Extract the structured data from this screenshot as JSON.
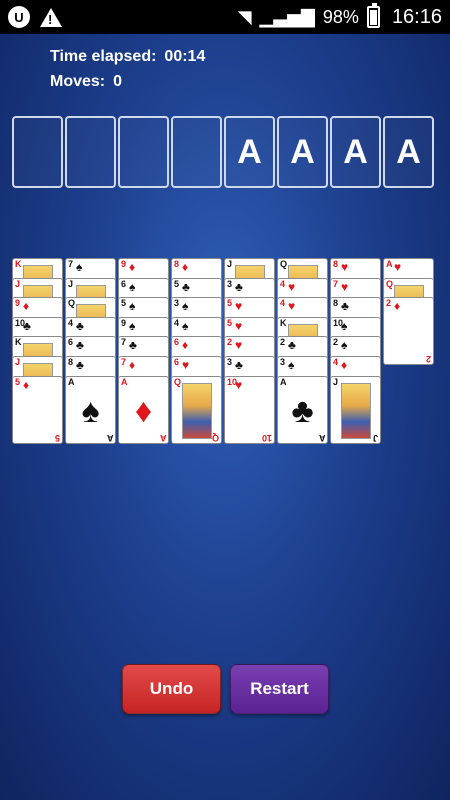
{
  "status_bar": {
    "app_icon": "U",
    "warning_icon": "!",
    "battery": "98%",
    "time": "16:16"
  },
  "hud": {
    "time_label": "Time elapsed:",
    "time_value": "00:14",
    "moves_label": "Moves:",
    "moves_value": "0"
  },
  "freecells": [
    "",
    "",
    "",
    ""
  ],
  "foundations": [
    "A",
    "A",
    "A",
    "A"
  ],
  "tableau": [
    [
      {
        "rank": "K",
        "suit": "♦",
        "color": "red",
        "face": true
      },
      {
        "rank": "J",
        "suit": "♦",
        "color": "red",
        "face": true
      },
      {
        "rank": "9",
        "suit": "♦",
        "color": "red"
      },
      {
        "rank": "10",
        "suit": "♣",
        "color": "black"
      },
      {
        "rank": "K",
        "suit": "♣",
        "color": "black",
        "face": true
      },
      {
        "rank": "J",
        "suit": "♦",
        "color": "red",
        "face": true
      },
      {
        "rank": "5",
        "suit": "♦",
        "color": "red",
        "last": true
      }
    ],
    [
      {
        "rank": "7",
        "suit": "♠",
        "color": "black"
      },
      {
        "rank": "J",
        "suit": "♠",
        "color": "black",
        "face": true
      },
      {
        "rank": "Q",
        "suit": "♣",
        "color": "black",
        "face": true
      },
      {
        "rank": "4",
        "suit": "♣",
        "color": "black"
      },
      {
        "rank": "6",
        "suit": "♣",
        "color": "black"
      },
      {
        "rank": "8",
        "suit": "♣",
        "color": "black"
      },
      {
        "rank": "A",
        "suit": "♠",
        "color": "black",
        "last": true
      }
    ],
    [
      {
        "rank": "9",
        "suit": "♦",
        "color": "red"
      },
      {
        "rank": "6",
        "suit": "♠",
        "color": "black"
      },
      {
        "rank": "5",
        "suit": "♠",
        "color": "black"
      },
      {
        "rank": "9",
        "suit": "♠",
        "color": "black"
      },
      {
        "rank": "7",
        "suit": "♣",
        "color": "black"
      },
      {
        "rank": "7",
        "suit": "♦",
        "color": "red"
      },
      {
        "rank": "A",
        "suit": "♦",
        "color": "red",
        "last": true
      }
    ],
    [
      {
        "rank": "8",
        "suit": "♦",
        "color": "red"
      },
      {
        "rank": "5",
        "suit": "♣",
        "color": "black"
      },
      {
        "rank": "3",
        "suit": "♠",
        "color": "black"
      },
      {
        "rank": "4",
        "suit": "♠",
        "color": "black"
      },
      {
        "rank": "6",
        "suit": "♦",
        "color": "red"
      },
      {
        "rank": "6",
        "suit": "♥",
        "color": "red"
      },
      {
        "rank": "Q",
        "suit": "♦",
        "color": "red",
        "face": true,
        "last": true
      }
    ],
    [
      {
        "rank": "J",
        "suit": "♣",
        "color": "black",
        "face": true
      },
      {
        "rank": "3",
        "suit": "♣",
        "color": "black"
      },
      {
        "rank": "5",
        "suit": "♥",
        "color": "red"
      },
      {
        "rank": "5",
        "suit": "♥",
        "color": "red"
      },
      {
        "rank": "2",
        "suit": "♥",
        "color": "red"
      },
      {
        "rank": "3",
        "suit": "♣",
        "color": "black"
      },
      {
        "rank": "10",
        "suit": "♥",
        "color": "red",
        "last": true
      }
    ],
    [
      {
        "rank": "Q",
        "suit": "♠",
        "color": "black",
        "face": true
      },
      {
        "rank": "4",
        "suit": "♥",
        "color": "red"
      },
      {
        "rank": "4",
        "suit": "♥",
        "color": "red"
      },
      {
        "rank": "K",
        "suit": "♣",
        "color": "black",
        "face": true
      },
      {
        "rank": "2",
        "suit": "♣",
        "color": "black"
      },
      {
        "rank": "3",
        "suit": "♠",
        "color": "black"
      },
      {
        "rank": "A",
        "suit": "♣",
        "color": "black",
        "last": true
      }
    ],
    [
      {
        "rank": "8",
        "suit": "♥",
        "color": "red"
      },
      {
        "rank": "7",
        "suit": "♥",
        "color": "red"
      },
      {
        "rank": "8",
        "suit": "♣",
        "color": "black"
      },
      {
        "rank": "10",
        "suit": "♠",
        "color": "black"
      },
      {
        "rank": "2",
        "suit": "♠",
        "color": "black"
      },
      {
        "rank": "4",
        "suit": "♦",
        "color": "red"
      },
      {
        "rank": "J",
        "suit": "♠",
        "color": "black",
        "face": true,
        "last": true
      }
    ],
    [
      {
        "rank": "A",
        "suit": "♥",
        "color": "red"
      },
      {
        "rank": "Q",
        "suit": "♥",
        "color": "red",
        "face": true
      },
      {
        "rank": "2",
        "suit": "♦",
        "color": "red",
        "last": true
      }
    ]
  ],
  "buttons": {
    "undo": "Undo",
    "restart": "Restart"
  }
}
